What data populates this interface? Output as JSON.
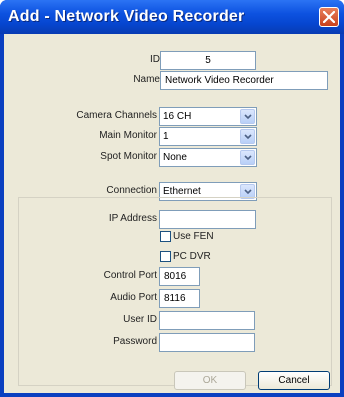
{
  "window": {
    "title": "Add - Network Video Recorder"
  },
  "fields": {
    "id": {
      "label": "ID",
      "value": "5"
    },
    "name": {
      "label": "Name",
      "value": "Network Video Recorder"
    },
    "camera_channels": {
      "label": "Camera Channels",
      "value": "16 CH"
    },
    "main_monitor": {
      "label": "Main Monitor",
      "value": "1"
    },
    "spot_monitor": {
      "label": "Spot Monitor",
      "value": "None"
    },
    "connection": {
      "label": "Connection",
      "value": "Ethernet"
    },
    "ip_address": {
      "label": "IP Address",
      "value": ""
    },
    "use_fen": {
      "label": "Use FEN",
      "checked": false
    },
    "pc_dvr": {
      "label": "PC DVR",
      "checked": false
    },
    "control_port": {
      "label": "Control Port",
      "value": "8016"
    },
    "audio_port": {
      "label": "Audio Port",
      "value": "8116"
    },
    "user_id": {
      "label": "User ID",
      "value": ""
    },
    "password": {
      "label": "Password",
      "value": ""
    }
  },
  "buttons": {
    "ok": "OK",
    "cancel": "Cancel"
  },
  "colors": {
    "titlebar": "#0d52e0",
    "client": "#ece9d8",
    "close": "#d9532c"
  }
}
